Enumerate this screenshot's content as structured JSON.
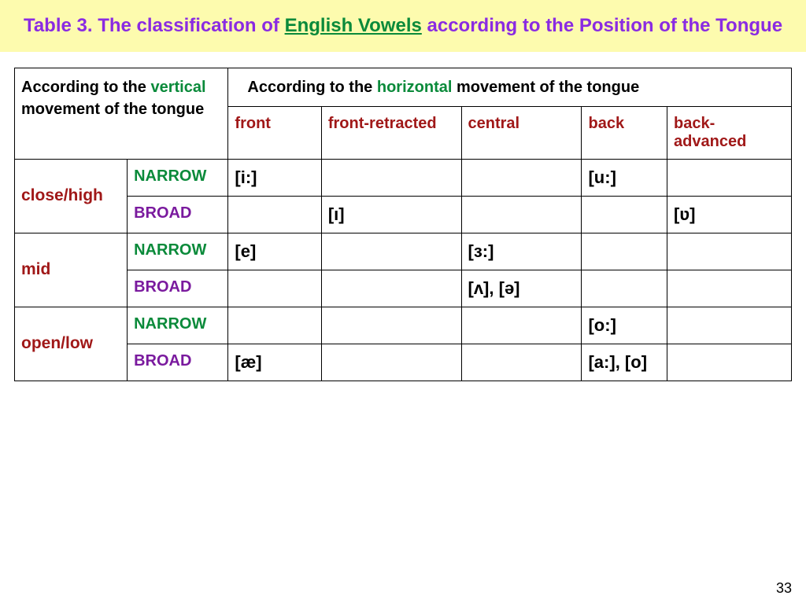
{
  "title": {
    "prefix": "Table 3. The classification of ",
    "emph": "English Vowels",
    "suffix": " according to the Position of the Tongue"
  },
  "headers": {
    "vertical_prefix": "According to the ",
    "vertical_em": "vertical",
    "vertical_suffix": " movement of the tongue",
    "horizontal_prefix": "According to the ",
    "horizontal_em": "horizontal",
    "horizontal_suffix": " movement of the tongue"
  },
  "columns": {
    "front": "front",
    "front_retracted": "front-retracted",
    "central": "central",
    "back": "back",
    "back_advanced": "back-advanced"
  },
  "row_groups": {
    "close_high": "close/high",
    "mid": "mid",
    "open_low": "open/low"
  },
  "subrows": {
    "narrow": "narrow",
    "broad": "broad"
  },
  "cells": {
    "close_high": {
      "narrow": {
        "front": "[i:]",
        "front_retracted": "",
        "central": "",
        "back": "[u:]",
        "back_advanced": ""
      },
      "broad": {
        "front": "",
        "front_retracted": "[ı]",
        "central": "",
        "back": "",
        "back_advanced": "[ʋ]"
      }
    },
    "mid": {
      "narrow": {
        "front": "[e]",
        "front_retracted": "",
        "central": "[ɜ:]",
        "back": "",
        "back_advanced": ""
      },
      "broad": {
        "front": "",
        "front_retracted": "",
        "central": "[ʌ], [ə]",
        "back": "",
        "back_advanced": ""
      }
    },
    "open_low": {
      "narrow": {
        "front": "",
        "front_retracted": "",
        "central": "",
        "back": "[o:]",
        "back_advanced": ""
      },
      "broad": {
        "front": "[æ]",
        "front_retracted": "",
        "central": "",
        "back": "[a:], [o]",
        "back_advanced": ""
      }
    }
  },
  "pagenum": "33"
}
